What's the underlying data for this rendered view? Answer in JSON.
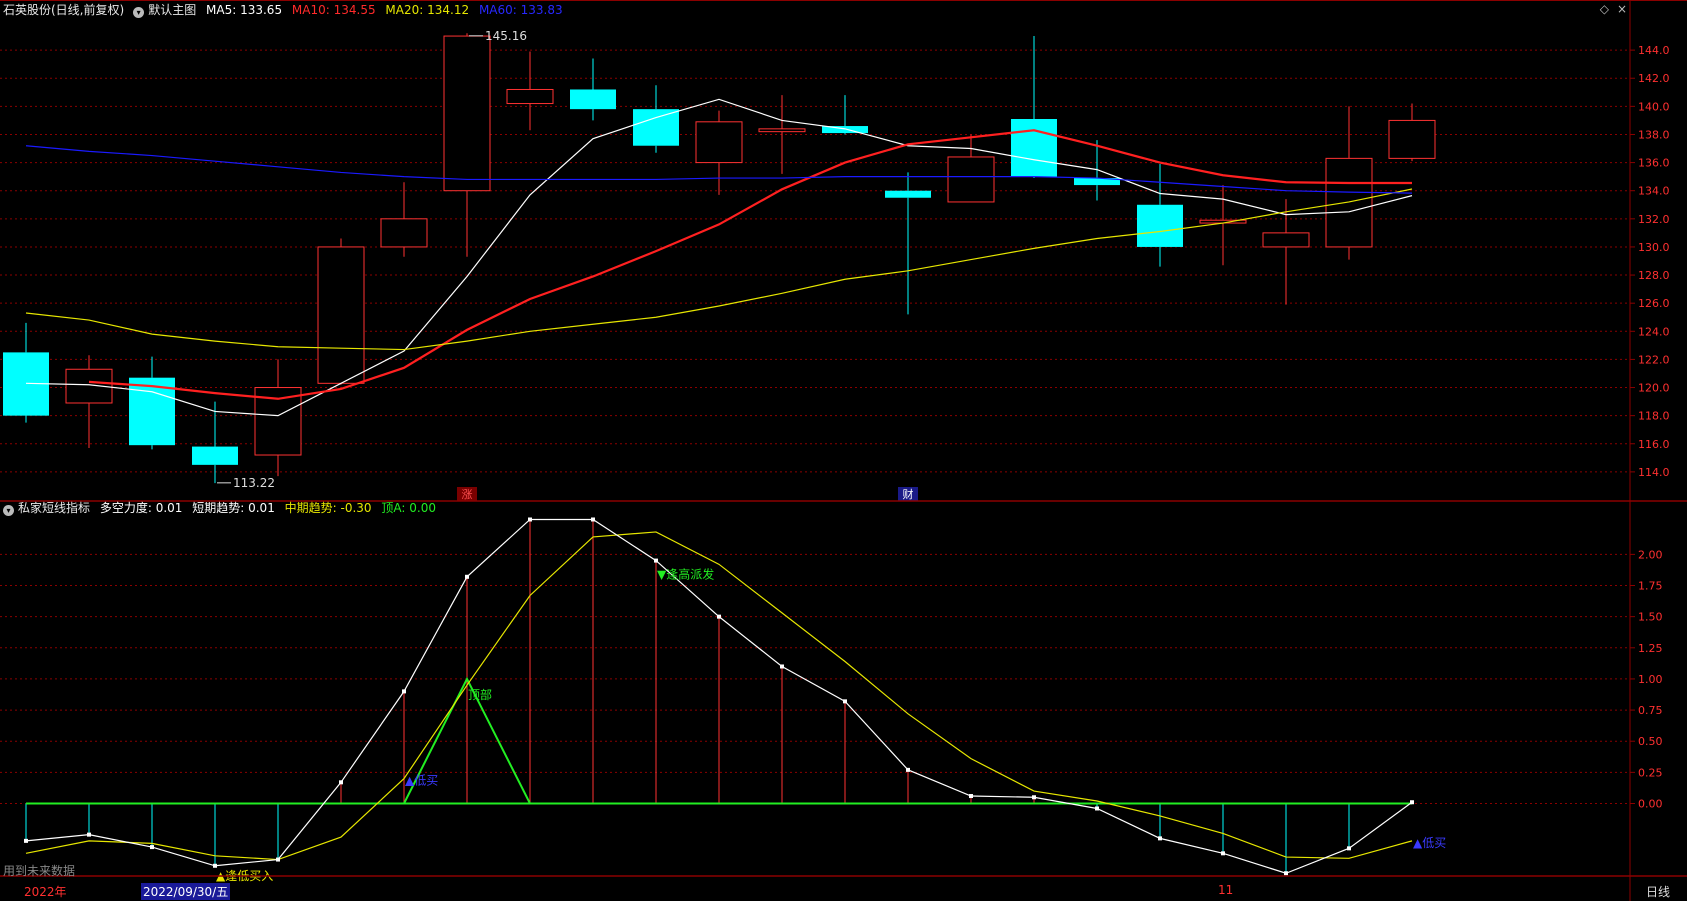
{
  "header": {
    "stock": "石英股份(日线,前复权)",
    "main_chart": "默认主图",
    "ma5_label": "MA5: 133.65",
    "ma10_label": "MA10: 134.55",
    "ma20_label": "MA20: 134.12",
    "ma60_label": "MA60: 133.83"
  },
  "indicator_header": {
    "name": "私家短线指标",
    "duokong": "多空力度: 0.01",
    "short_trend": "短期趋势: 0.01",
    "mid_trend": "中期趋势: -0.30",
    "top_a": "顶A: 0.00"
  },
  "footer": {
    "future_data": "用到未来数据",
    "year": "2022年",
    "date_cursor": "2022/09/30/五",
    "month_mark": "11",
    "period": "日线"
  },
  "colors": {
    "up": "#ff3232",
    "down": "#00ffff",
    "ma5": "#ffffff",
    "ma10": "#ff2020",
    "ma20": "#e6e600",
    "ma60": "#1a1aff",
    "grid": "#8b0000",
    "indicator_green": "#22ee22"
  },
  "chart_data": [
    {
      "type": "candlestick",
      "title": "石英股份(日线,前复权)",
      "ylim": [
        112,
        146
      ],
      "yticks": [
        114.0,
        116.0,
        118.0,
        120.0,
        122.0,
        124.0,
        126.0,
        128.0,
        130.0,
        132.0,
        134.0,
        136.0,
        138.0,
        140.0,
        142.0,
        144.0
      ],
      "candles": [
        {
          "open": 122.5,
          "high": 124.6,
          "low": 117.5,
          "close": 118.0
        },
        {
          "open": 118.9,
          "high": 122.3,
          "low": 115.7,
          "close": 121.3
        },
        {
          "open": 120.7,
          "high": 122.2,
          "low": 115.6,
          "close": 115.9
        },
        {
          "open": 115.8,
          "high": 119.0,
          "low": 113.2,
          "close": 114.5
        },
        {
          "open": 115.2,
          "high": 122.0,
          "low": 113.7,
          "close": 120.0
        },
        {
          "open": 120.3,
          "high": 130.6,
          "low": 120.2,
          "close": 130.0
        },
        {
          "open": 130.0,
          "high": 134.6,
          "low": 129.3,
          "close": 132.0
        },
        {
          "open": 134.0,
          "high": 145.2,
          "low": 129.3,
          "close": 145.0
        },
        {
          "open": 140.2,
          "high": 143.9,
          "low": 138.3,
          "close": 141.2
        },
        {
          "open": 141.2,
          "high": 143.4,
          "low": 139.0,
          "close": 139.8
        },
        {
          "open": 139.8,
          "high": 141.5,
          "low": 136.7,
          "close": 137.2
        },
        {
          "open": 136.0,
          "high": 139.7,
          "low": 133.7,
          "close": 138.9
        },
        {
          "open": 138.2,
          "high": 140.8,
          "low": 135.2,
          "close": 138.4
        },
        {
          "open": 138.6,
          "high": 140.8,
          "low": 138.0,
          "close": 138.1
        },
        {
          "open": 134.0,
          "high": 135.3,
          "low": 125.2,
          "close": 133.5
        },
        {
          "open": 133.2,
          "high": 138.0,
          "low": 133.2,
          "close": 136.4
        },
        {
          "open": 139.1,
          "high": 145.0,
          "low": 134.9,
          "close": 135.0
        },
        {
          "open": 134.9,
          "high": 137.6,
          "low": 133.3,
          "close": 134.4
        },
        {
          "open": 133.0,
          "high": 135.9,
          "low": 128.6,
          "close": 130.0
        },
        {
          "open": 131.7,
          "high": 134.4,
          "low": 128.7,
          "close": 131.9
        },
        {
          "open": 130.0,
          "high": 133.4,
          "low": 125.9,
          "close": 131.0
        },
        {
          "open": 130.0,
          "high": 140.0,
          "low": 129.1,
          "close": 136.3
        },
        {
          "open": 136.3,
          "high": 140.2,
          "low": 136.1,
          "close": 139.0
        }
      ],
      "series": [
        {
          "name": "MA5",
          "values": [
            120.3,
            120.2,
            119.7,
            118.3,
            118.0,
            120.3,
            122.6,
            127.9,
            133.7,
            137.7,
            139.2,
            140.5,
            139.0,
            138.4,
            137.2,
            137.0,
            136.2,
            135.5,
            133.8,
            133.4,
            132.3,
            132.5,
            133.65
          ]
        },
        {
          "name": "MA10",
          "values": [
            null,
            120.4,
            120.1,
            119.6,
            119.2,
            119.9,
            121.4,
            124.1,
            126.3,
            127.9,
            129.7,
            131.6,
            134.1,
            136.0,
            137.3,
            137.8,
            138.3,
            137.2,
            136.0,
            135.1,
            134.6,
            134.55,
            134.55
          ]
        },
        {
          "name": "MA20",
          "values": [
            125.3,
            124.8,
            123.8,
            123.3,
            122.9,
            122.8,
            122.7,
            123.3,
            124.0,
            124.5,
            125.0,
            125.8,
            126.7,
            127.7,
            128.3,
            129.1,
            129.9,
            130.6,
            131.1,
            131.7,
            132.5,
            133.2,
            134.12
          ]
        },
        {
          "name": "MA60",
          "values": [
            137.2,
            136.8,
            136.5,
            136.1,
            135.7,
            135.3,
            135.0,
            134.8,
            134.8,
            134.8,
            134.8,
            134.9,
            134.9,
            135.0,
            135.0,
            135.0,
            135.0,
            134.9,
            134.6,
            134.3,
            134.0,
            133.9,
            133.83
          ]
        }
      ],
      "annotations": [
        {
          "label": "145.16",
          "index": 7,
          "value": 145.16
        },
        {
          "label": "113.22",
          "index": 3,
          "value": 113.22
        },
        {
          "label": "涨",
          "index": 7
        },
        {
          "label": "财",
          "index": 14
        }
      ]
    },
    {
      "type": "line",
      "title": "私家短线指标",
      "ylim": [
        -0.55,
        2.3
      ],
      "yticks": [
        0.0,
        0.25,
        0.5,
        0.75,
        1.0,
        1.25,
        1.5,
        1.75,
        2.0
      ],
      "ytick_labels": [
        "0.00",
        "0.25",
        "0.50",
        "0.75",
        "1.00",
        "1.25",
        "1.50",
        "1.75",
        "2.00"
      ],
      "series": [
        {
          "name": "多空力度",
          "values": [
            -0.3,
            -0.25,
            -0.35,
            -0.5,
            -0.45,
            0.17,
            0.9,
            1.82,
            2.28,
            2.28,
            1.95,
            1.5,
            1.1,
            0.82,
            0.27,
            0.06,
            0.05,
            -0.04,
            -0.28,
            -0.4,
            -0.56,
            -0.36,
            0.01
          ]
        },
        {
          "name": "中期趋势",
          "values": [
            -0.4,
            -0.3,
            -0.32,
            -0.42,
            -0.45,
            -0.27,
            0.2,
            0.95,
            1.67,
            2.14,
            2.18,
            1.92,
            1.53,
            1.14,
            0.72,
            0.36,
            0.1,
            0.02,
            -0.1,
            -0.24,
            -0.43,
            -0.44,
            -0.3
          ]
        },
        {
          "name": "顶A",
          "values": [
            0,
            0,
            0,
            0,
            0,
            0,
            0,
            1.0,
            0,
            0,
            0,
            0,
            0,
            0,
            0,
            0,
            0,
            0,
            0,
            0,
            0,
            0,
            0
          ]
        }
      ],
      "annotations": [
        {
          "label": "▲逢低买入",
          "index": 3
        },
        {
          "label": "▲低买",
          "index": 6
        },
        {
          "label": "顶部",
          "index": 7
        },
        {
          "label": "▼逢高派发",
          "index": 10
        },
        {
          "label": "▲低买",
          "index": 22
        }
      ]
    }
  ]
}
